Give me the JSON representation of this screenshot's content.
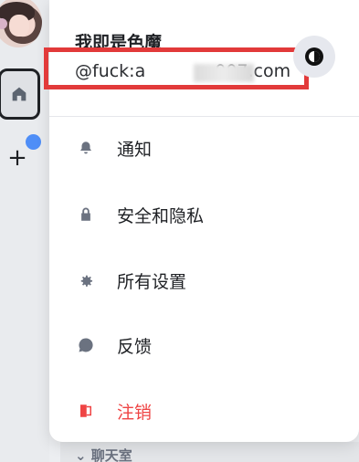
{
  "user": {
    "name": "我即是色魔",
    "email": "@fuck:a           07.com",
    "email_visible_prefix": "@fuck:a",
    "email_visible_suffix": "007.com"
  },
  "rail": {
    "add_label": "+"
  },
  "menu": {
    "items": [
      {
        "label": "通知",
        "icon": "bell-icon"
      },
      {
        "label": "安全和隐私",
        "icon": "lock-icon"
      },
      {
        "label": "所有设置",
        "icon": "gear-icon"
      },
      {
        "label": "反馈",
        "icon": "chat-bubble-icon"
      },
      {
        "label": "注销",
        "icon": "logout-icon"
      }
    ]
  },
  "background": {
    "section_label": "⌄ 聊天室"
  },
  "colors": {
    "accent": "#4f8ef7",
    "danger": "#ef4444",
    "highlight": "#e23a3a"
  }
}
